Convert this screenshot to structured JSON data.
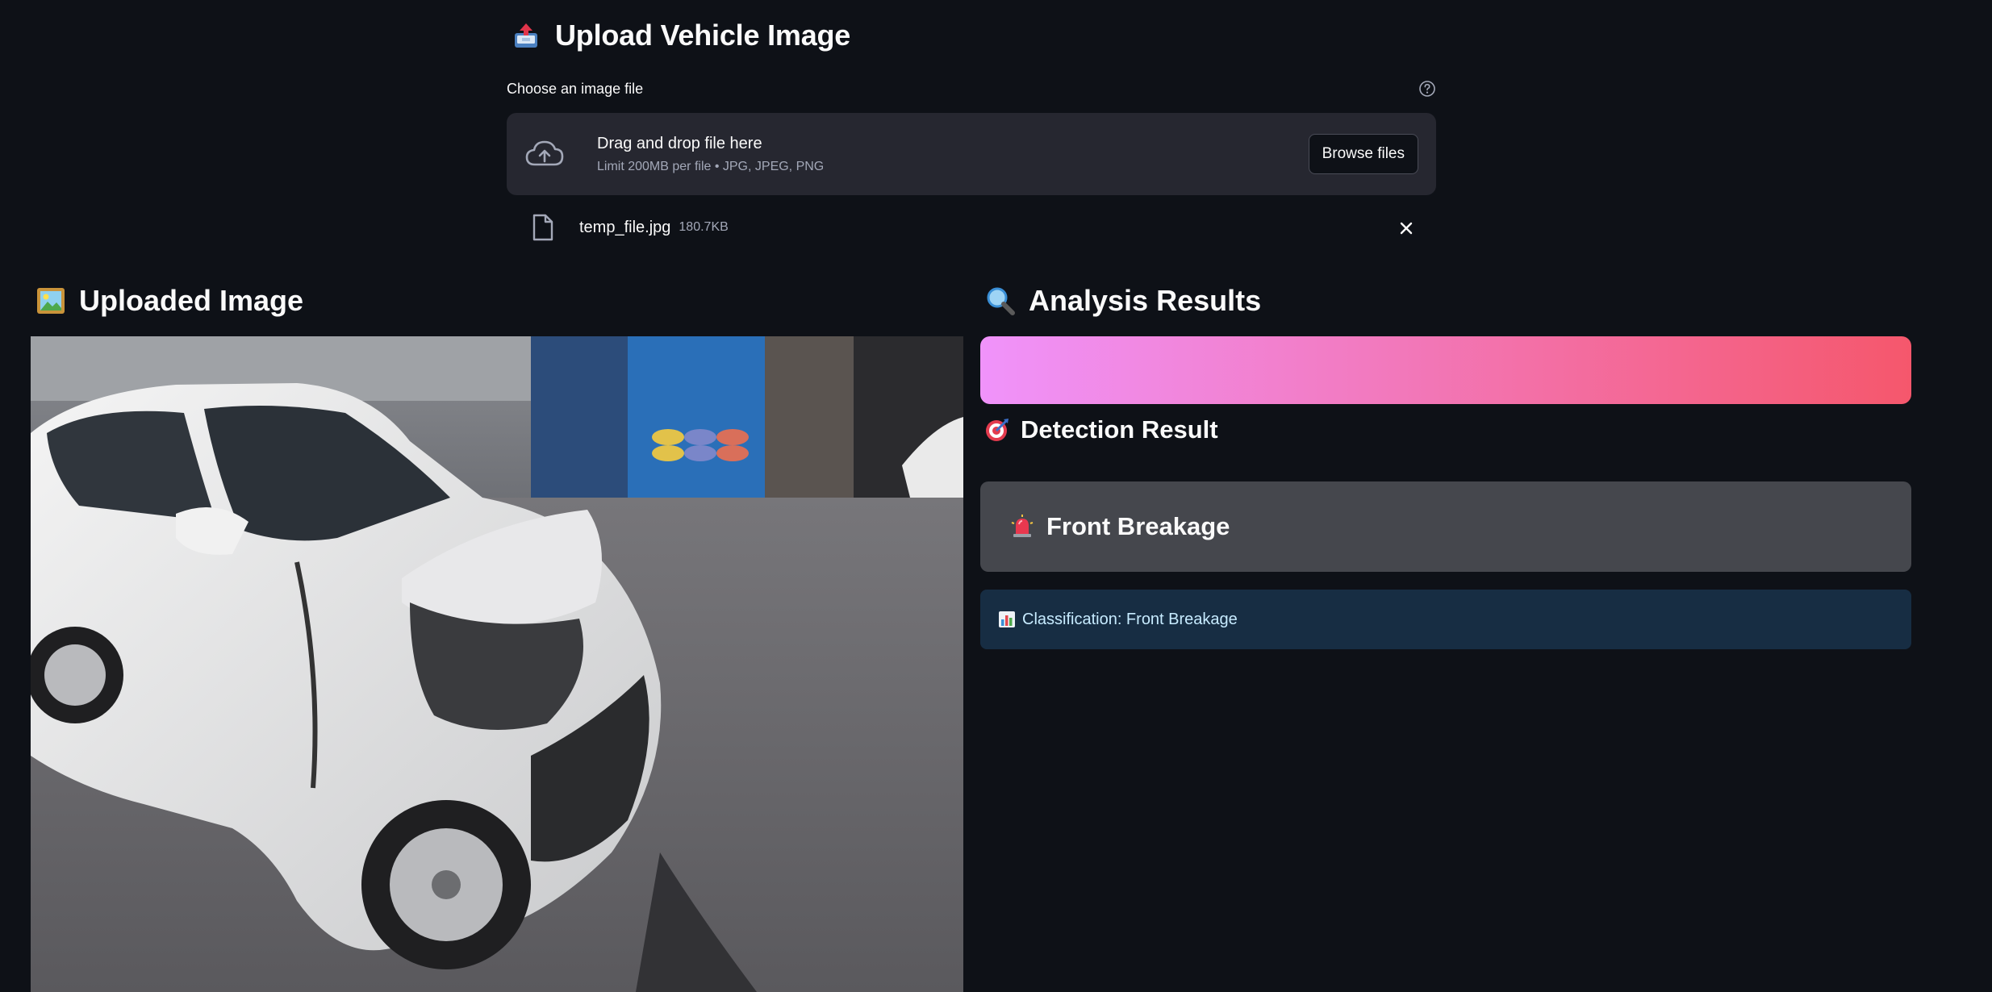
{
  "upload": {
    "heading": "Upload Vehicle Image",
    "heading_icon": "inbox-tray-icon",
    "label": "Choose an image file",
    "help_icon": "question-circle-icon",
    "dropzone_title": "Drag and drop file here",
    "dropzone_subtitle": "Limit 200MB per file • JPG, JPEG, PNG",
    "browse_label": "Browse files",
    "file": {
      "name": "temp_file.jpg",
      "size": "180.7KB"
    }
  },
  "left": {
    "heading": "Uploaded Image",
    "heading_icon": "framed-picture-icon"
  },
  "right": {
    "heading": "Analysis Results",
    "heading_icon": "magnifying-glass-icon",
    "progress_colors": [
      "#f093fb",
      "#f5576c"
    ],
    "detection_heading": "Detection Result",
    "detection_icon": "bullseye-icon",
    "result_label": "Front Breakage",
    "result_icon": "police-light-icon",
    "classification_text": "Classification: Front Breakage",
    "classification_icon": "bar-chart-icon"
  },
  "colors": {
    "background": "#0e1117",
    "dropzone": "#262730",
    "result_card": "#45474d",
    "info_box": "#172d43",
    "info_text": "#c7ebff"
  }
}
